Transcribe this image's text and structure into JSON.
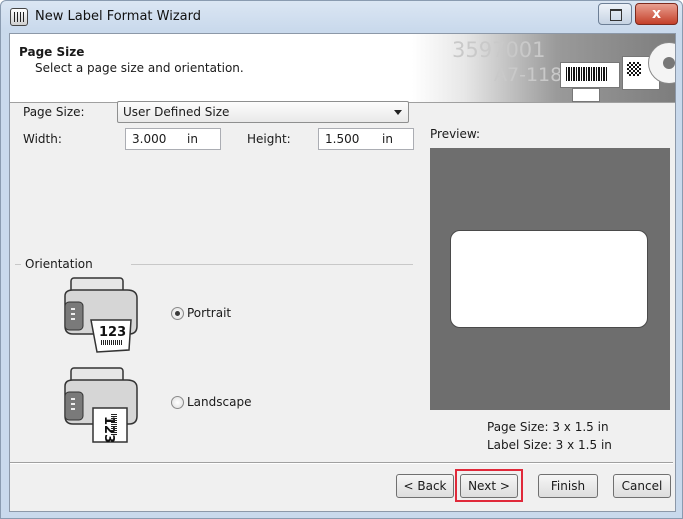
{
  "window": {
    "title": "New Label Format Wizard"
  },
  "titlebar": {
    "close_symbol": "x"
  },
  "header": {
    "title": "Page Size",
    "subtitle": "Select a page size and orientation.",
    "banner_number_1": "3597001",
    "banner_number_2": "A7-118"
  },
  "form": {
    "page_size_label": "Page Size:",
    "page_size_value": "User Defined Size",
    "width_label": "Width:",
    "width_value": "3.000",
    "width_unit": "in",
    "height_label": "Height:",
    "height_value": "1.500",
    "height_unit": "in"
  },
  "orientation": {
    "group_label": "Orientation",
    "portrait_label": "Portrait",
    "landscape_label": "Landscape",
    "selected": "Portrait",
    "printer_card_text": "123"
  },
  "preview": {
    "label": "Preview:",
    "page_size_text": "Page Size:  3 x 1.5 in",
    "label_size_text": "Label Size:  3 x 1.5 in"
  },
  "buttons": {
    "back": "< Back",
    "next": "Next >",
    "finish": "Finish",
    "cancel": "Cancel"
  },
  "colors": {
    "highlight": "#e0293a",
    "preview_background": "#6e6e6e"
  }
}
